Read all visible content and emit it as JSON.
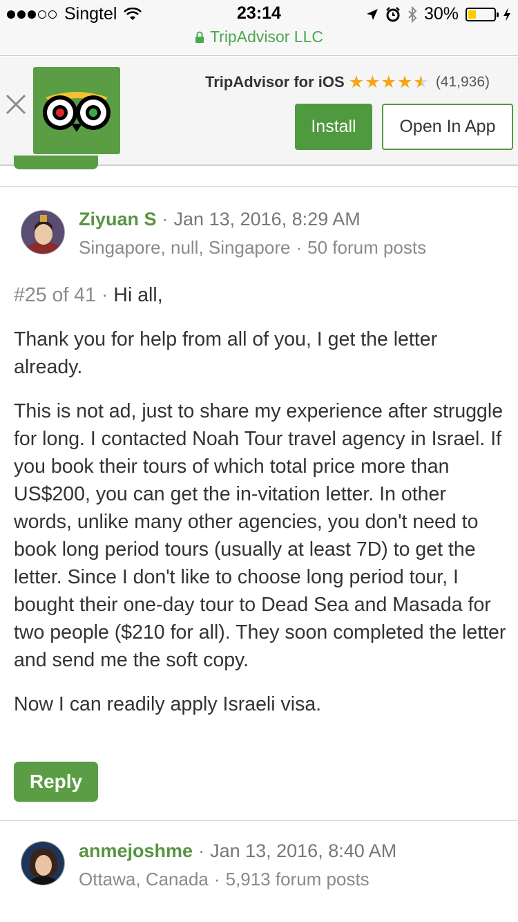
{
  "status_bar": {
    "carrier": "Singtel",
    "time": "23:14",
    "battery_percent": "30%",
    "battery_level": 0.3,
    "url": "TripAdvisor LLC"
  },
  "app_banner": {
    "app_name": "TripAdvisor for iOS",
    "rating": 4.5,
    "rating_count": "(41,936)",
    "install_label": "Install",
    "open_label": "Open In App"
  },
  "posts": [
    {
      "username": "Ziyuan S",
      "date": "Jan 13, 2016, 8:29 AM",
      "location": "Singapore, null, Singapore",
      "forum_posts": "50 forum posts",
      "post_number": "#25 of 41",
      "first_line": "Hi all,",
      "paragraphs": [
        "Thank you for help from all of you, I get the letter already.",
        "This is not ad, just to share my experience after struggle for long. I contacted Noah Tour travel agency in Israel. If you book their tours of which total price more than US$200, you can get the in-vitation letter. In other words, unlike many other agencies, you don't need to book long period tours (usually at least 7D) to get the letter. Since I don't like to choose long period tour, I bought their one-day tour to Dead Sea and Masada for two people ($210 for all). They soon completed the letter and send me the soft copy.",
        "Now I can readily apply Israeli visa."
      ],
      "reply_label": "Reply"
    },
    {
      "username": "anmejoshme",
      "date": "Jan 13, 2016, 8:40 AM",
      "location": "Ottawa, Canada",
      "forum_posts": "5,913 forum posts"
    }
  ]
}
